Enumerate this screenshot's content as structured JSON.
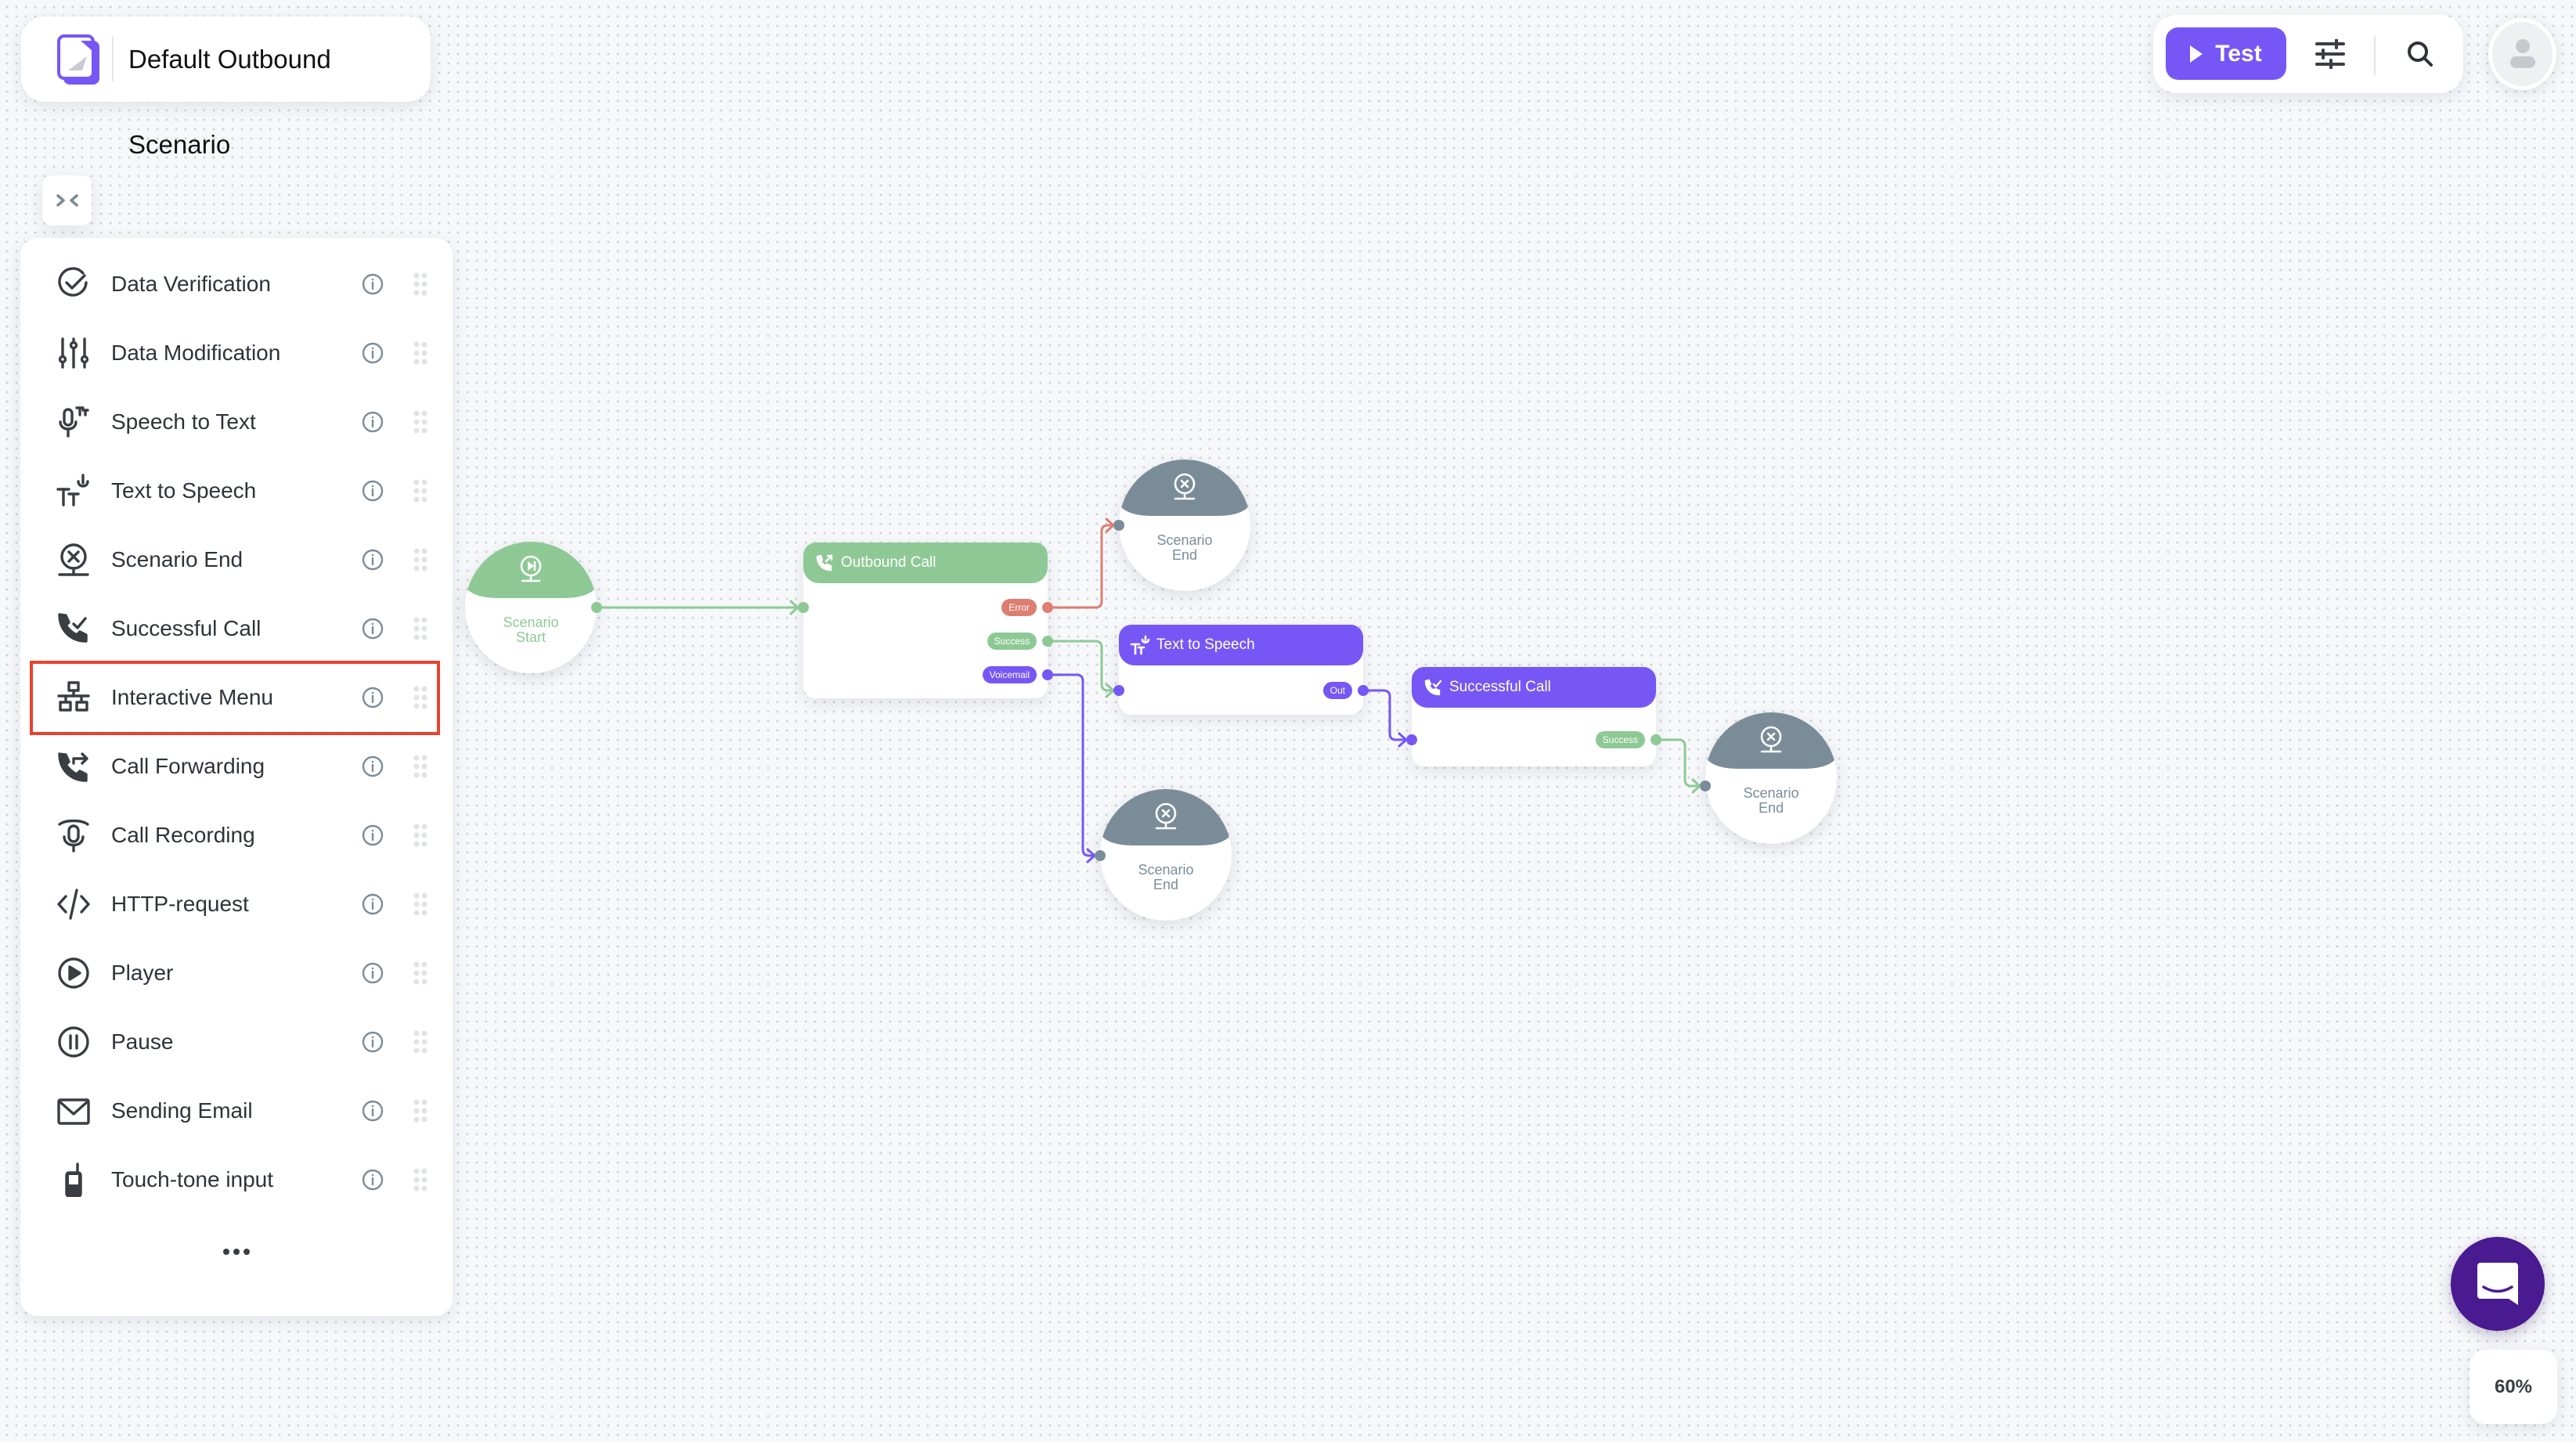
{
  "header": {
    "title": "Default Outbound Scenario",
    "logo": "app-logo"
  },
  "toolbar": {
    "test_label": "Test",
    "test_icon": "play-icon",
    "settings_icon": "sliders-icon",
    "search_icon": "search-icon"
  },
  "avatar": {
    "icon": "user-icon"
  },
  "collapse": {
    "icon": "collapse-chevrons-icon",
    "glyph": "><"
  },
  "sidebar": {
    "highlighted_index": 6,
    "items": [
      {
        "label": "Data Verification",
        "icon": "check-circle-icon"
      },
      {
        "label": "Data Modification",
        "icon": "sliders-vertical-icon"
      },
      {
        "label": "Speech to Text",
        "icon": "mic-text-icon"
      },
      {
        "label": "Text to Speech",
        "icon": "text-mic-icon"
      },
      {
        "label": "Scenario End",
        "icon": "scenario-end-icon"
      },
      {
        "label": "Successful Call",
        "icon": "phone-check-icon"
      },
      {
        "label": "Interactive Menu",
        "icon": "sitemap-icon"
      },
      {
        "label": "Call Forwarding",
        "icon": "phone-forward-icon"
      },
      {
        "label": "Call Recording",
        "icon": "call-recording-icon"
      },
      {
        "label": "HTTP-request",
        "icon": "code-icon"
      },
      {
        "label": "Player",
        "icon": "play-circle-icon"
      },
      {
        "label": "Pause",
        "icon": "pause-circle-icon"
      },
      {
        "label": "Sending Email",
        "icon": "mail-icon"
      },
      {
        "label": "Touch-tone input",
        "icon": "mobile-phone-icon"
      }
    ],
    "more_label": "more"
  },
  "colors": {
    "accent": "#7657f5",
    "green": "#8ec995",
    "error": "#dd7e70",
    "gray_node": "#7b8c99",
    "chat": "#4a1a91",
    "highlight": "#e8432d"
  },
  "flow": {
    "nodes": {
      "start": {
        "label_line1": "Scenario",
        "label_line2": "Start"
      },
      "outbound_call": {
        "title": "Outbound Call",
        "ports": {
          "error": "Error",
          "success": "Success",
          "voicemail": "Voicemail"
        }
      },
      "end_top": {
        "label_line1": "Scenario",
        "label_line2": "End"
      },
      "tts": {
        "title": "Text to Speech",
        "ports": {
          "out": "Out"
        }
      },
      "end_bottom": {
        "label_line1": "Scenario",
        "label_line2": "End"
      },
      "successful_call": {
        "title": "Successful Call",
        "ports": {
          "success": "Success"
        }
      },
      "end_right": {
        "label_line1": "Scenario",
        "label_line2": "End"
      }
    },
    "edges": [
      {
        "from": "start",
        "to": "outbound_call",
        "color": "green"
      },
      {
        "from": "outbound_call.error",
        "to": "end_top",
        "color": "error"
      },
      {
        "from": "outbound_call.success",
        "to": "tts",
        "color": "green"
      },
      {
        "from": "outbound_call.voicemail",
        "to": "end_bottom",
        "color": "accent"
      },
      {
        "from": "tts.out",
        "to": "successful_call",
        "color": "accent"
      },
      {
        "from": "successful_call.success",
        "to": "end_right",
        "color": "green"
      }
    ]
  },
  "zoom": {
    "level": "60%"
  },
  "chat": {
    "icon": "chat-smile-icon"
  }
}
